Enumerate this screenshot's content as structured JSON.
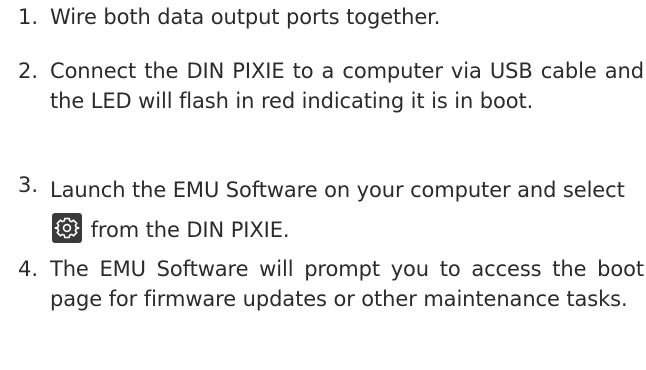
{
  "steps": [
    {
      "number": "1.",
      "text": "Wire both data output ports together."
    },
    {
      "number": "2.",
      "text": "Connect the DIN PIXIE to a computer via USB cable and the LED will flash in red indicating it is in boot."
    },
    {
      "number": "3.",
      "text_before_icon": "Launch the EMU Software on your computer and select",
      "icon": "gear-icon",
      "text_after_icon": "from the DIN PIXIE."
    },
    {
      "number": "4.",
      "text": "The EMU Software will prompt you to access the boot page for firmware updates or other maintenance tasks."
    }
  ],
  "colors": {
    "text": "#2b2b2b",
    "icon_background": "#3a3a3a",
    "icon_foreground": "#ffffff"
  }
}
